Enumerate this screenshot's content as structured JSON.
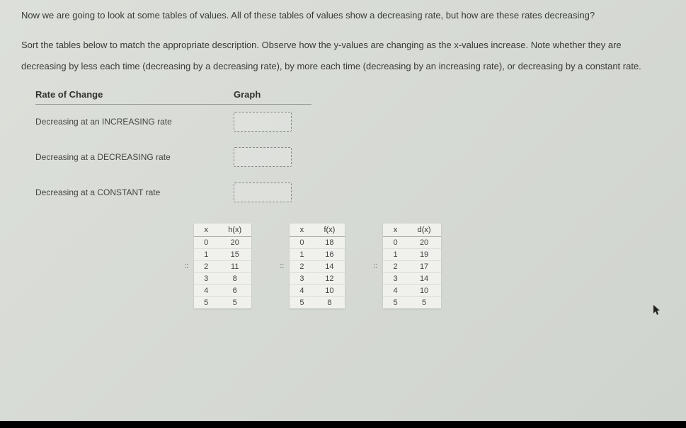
{
  "intro": "Now we are going to look at some tables of values. All of these tables of values show a decreasing rate, but how are these rates decreasing?",
  "instructions": "Sort the tables below to match the appropriate description.  Observe how the y-values are changing as the x-values increase.  Note whether they are decreasing by less each time (decreasing by a decreasing rate), by more each time (decreasing by an increasing rate), or decreasing by a constant rate.",
  "sort": {
    "header_rate": "Rate of Change",
    "header_graph": "Graph",
    "rows": [
      {
        "label": "Decreasing at an INCREASING rate"
      },
      {
        "label": "Decreasing at a DECREASING rate"
      },
      {
        "label": "Decreasing at a CONSTANT rate"
      }
    ]
  },
  "tables": [
    {
      "x_label": "x",
      "y_label": "h(x)",
      "rows": [
        {
          "x": "0",
          "y": "20"
        },
        {
          "x": "1",
          "y": "15"
        },
        {
          "x": "2",
          "y": "11"
        },
        {
          "x": "3",
          "y": "8"
        },
        {
          "x": "4",
          "y": "6"
        },
        {
          "x": "5",
          "y": "5"
        }
      ]
    },
    {
      "x_label": "x",
      "y_label": "f(x)",
      "rows": [
        {
          "x": "0",
          "y": "18"
        },
        {
          "x": "1",
          "y": "16"
        },
        {
          "x": "2",
          "y": "14"
        },
        {
          "x": "3",
          "y": "12"
        },
        {
          "x": "4",
          "y": "10"
        },
        {
          "x": "5",
          "y": "8"
        }
      ]
    },
    {
      "x_label": "x",
      "y_label": "d(x)",
      "rows": [
        {
          "x": "0",
          "y": "20"
        },
        {
          "x": "1",
          "y": "19"
        },
        {
          "x": "2",
          "y": "17"
        },
        {
          "x": "3",
          "y": "14"
        },
        {
          "x": "4",
          "y": "10"
        },
        {
          "x": "5",
          "y": "5"
        }
      ]
    }
  ],
  "drag_handle": "::"
}
